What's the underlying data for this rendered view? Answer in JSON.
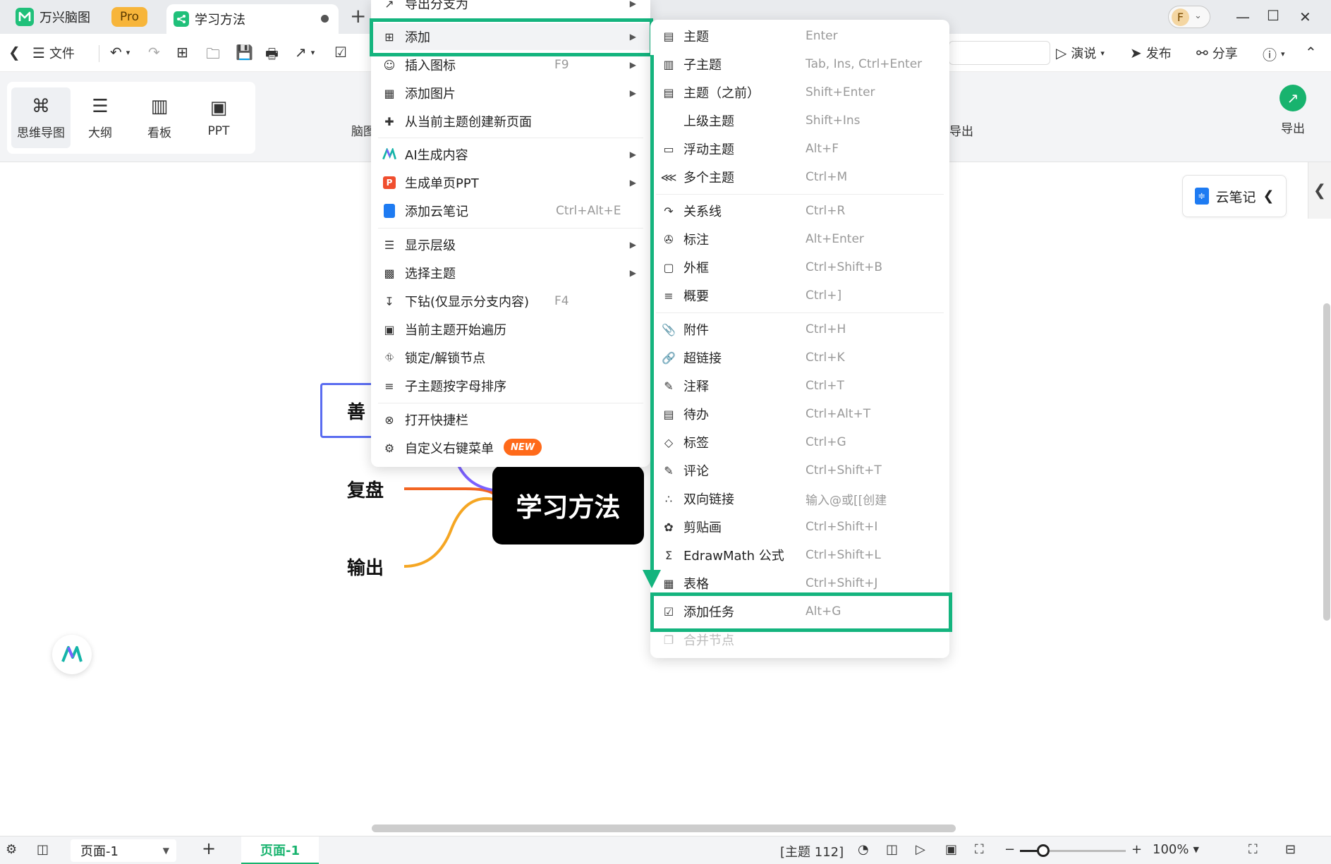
{
  "app": {
    "name": "万兴脑图",
    "pro_badge": "Pro",
    "document_tab": "学习方法"
  },
  "toolbar": {
    "file_label": "文件",
    "present_label": "演说",
    "publish_label": "发布",
    "share_label": "分享"
  },
  "views": {
    "items": [
      {
        "label": "思维导图",
        "icon": "mindmap-icon"
      },
      {
        "label": "大纲",
        "icon": "outline-icon"
      },
      {
        "label": "看板",
        "icon": "kanban-icon"
      },
      {
        "label": "PPT",
        "icon": "ppt-icon"
      }
    ],
    "active_index": 0
  },
  "ribbon": {
    "partial_left": "脑图",
    "partial_right": "导出",
    "export_label": "导出"
  },
  "canvas": {
    "cloud_note_label": "云笔记",
    "root_topic": "学习方法",
    "topics": [
      "善",
      "复盘",
      "输出"
    ]
  },
  "context_menu": {
    "items": [
      {
        "id": "export-branch",
        "label": "导出分支为",
        "shortcut": "",
        "submenu": true,
        "icon": "export-icon"
      },
      {
        "id": "add",
        "label": "添加",
        "shortcut": "",
        "submenu": true,
        "icon": "plus-square-icon"
      },
      {
        "id": "insert-icon",
        "label": "插入图标",
        "shortcut": "F9",
        "submenu": true,
        "icon": "smile-icon"
      },
      {
        "id": "add-image",
        "label": "添加图片",
        "shortcut": "",
        "submenu": true,
        "icon": "image-icon"
      },
      {
        "id": "new-page",
        "label": "从当前主题创建新页面",
        "shortcut": "",
        "submenu": false,
        "icon": "file-plus-icon"
      },
      {
        "id": "ai-generate",
        "label": "AI生成内容",
        "shortcut": "",
        "submenu": true,
        "icon": "ai-icon"
      },
      {
        "id": "gen-ppt",
        "label": "生成单页PPT",
        "shortcut": "",
        "submenu": true,
        "icon": "ppt-badge-icon"
      },
      {
        "id": "add-cloud-note",
        "label": "添加云笔记",
        "shortcut": "Ctrl+Alt+E",
        "submenu": false,
        "icon": "cloud-note-icon"
      },
      {
        "id": "show-level",
        "label": "显示层级",
        "shortcut": "",
        "submenu": true,
        "icon": "layers-icon"
      },
      {
        "id": "select-topic",
        "label": "选择主题",
        "shortcut": "",
        "submenu": true,
        "icon": "select-icon"
      },
      {
        "id": "drill-down",
        "label": "下钻(仅显示分支内容)",
        "shortcut": "F4",
        "submenu": false,
        "icon": "drill-down-icon"
      },
      {
        "id": "traverse",
        "label": "当前主题开始遍历",
        "shortcut": "",
        "submenu": false,
        "icon": "traverse-icon"
      },
      {
        "id": "lock",
        "label": "锁定/解锁节点",
        "shortcut": "",
        "submenu": false,
        "icon": "lock-icon"
      },
      {
        "id": "sort",
        "label": "子主题按字母排序",
        "shortcut": "",
        "submenu": false,
        "icon": "sort-icon"
      },
      {
        "id": "quickbar",
        "label": "打开快捷栏",
        "shortcut": "",
        "submenu": false,
        "icon": "close-circle-icon"
      },
      {
        "id": "customize",
        "label": "自定义右键菜单",
        "shortcut": "",
        "submenu": false,
        "icon": "gear-icon",
        "badge": "NEW"
      }
    ]
  },
  "submenu": {
    "items": [
      {
        "id": "topic",
        "label": "主题",
        "shortcut": "Enter",
        "icon": "topic-icon"
      },
      {
        "id": "subtopic",
        "label": "子主题",
        "shortcut": "Tab, Ins, Ctrl+Enter",
        "icon": "subtopic-icon"
      },
      {
        "id": "topic-before",
        "label": "主题（之前）",
        "shortcut": "Shift+Enter",
        "icon": "topic-before-icon"
      },
      {
        "id": "parent-topic",
        "label": "上级主题",
        "shortcut": "Shift+Ins",
        "icon": ""
      },
      {
        "id": "floating-topic",
        "label": "浮动主题",
        "shortcut": "Alt+F",
        "icon": "floating-topic-icon"
      },
      {
        "id": "multiple-topics",
        "label": "多个主题",
        "shortcut": "Ctrl+M",
        "icon": "multiple-topics-icon"
      },
      {
        "id": "relationship",
        "label": "关系线",
        "shortcut": "Ctrl+R",
        "icon": "relationship-icon"
      },
      {
        "id": "callout",
        "label": "标注",
        "shortcut": "Alt+Enter",
        "icon": "callout-icon"
      },
      {
        "id": "boundary",
        "label": "外框",
        "shortcut": "Ctrl+Shift+B",
        "icon": "boundary-icon"
      },
      {
        "id": "summary",
        "label": "概要",
        "shortcut": "Ctrl+]",
        "icon": "summary-icon"
      },
      {
        "id": "attachment",
        "label": "附件",
        "shortcut": "Ctrl+H",
        "icon": "paperclip-icon"
      },
      {
        "id": "hyperlink",
        "label": "超链接",
        "shortcut": "Ctrl+K",
        "icon": "link-icon"
      },
      {
        "id": "note",
        "label": "注释",
        "shortcut": "Ctrl+T",
        "icon": "pencil-icon"
      },
      {
        "id": "todo",
        "label": "待办",
        "shortcut": "Ctrl+Alt+T",
        "icon": "todo-icon"
      },
      {
        "id": "tag",
        "label": "标签",
        "shortcut": "Ctrl+G",
        "icon": "tag-icon"
      },
      {
        "id": "comment",
        "label": "评论",
        "shortcut": "Ctrl+Shift+T",
        "icon": "comment-icon"
      },
      {
        "id": "bilink",
        "label": "双向链接",
        "shortcut": "输入@或[[创建",
        "icon": "bilink-icon"
      },
      {
        "id": "clipart",
        "label": "剪贴画",
        "shortcut": "Ctrl+Shift+I",
        "icon": "clipart-icon"
      },
      {
        "id": "math",
        "label": "EdrawMath 公式",
        "shortcut": "Ctrl+Shift+L",
        "icon": "sigma-icon"
      },
      {
        "id": "table",
        "label": "表格",
        "shortcut": "Ctrl+Shift+J",
        "icon": "table-icon"
      },
      {
        "id": "add-task",
        "label": "添加任务",
        "shortcut": "Alt+G",
        "icon": "task-icon"
      },
      {
        "id": "merge",
        "label": "合并节点",
        "shortcut": "",
        "icon": "merge-icon",
        "disabled": true
      }
    ]
  },
  "statusbar": {
    "page_select": "页面-1",
    "active_page_tab": "页面-1",
    "topic_count": "[主题 112]",
    "zoom": "100%",
    "zoom_fraction": 0.22
  },
  "colors": {
    "accent_green": "#14b47e",
    "root_bg": "#000000",
    "topic_border": "#5a6cf0",
    "branch_orange": "#f26522",
    "branch_yellow": "#f5a623",
    "branch_purple": "#7b61ff",
    "new_badge": "#ff6a1a"
  }
}
